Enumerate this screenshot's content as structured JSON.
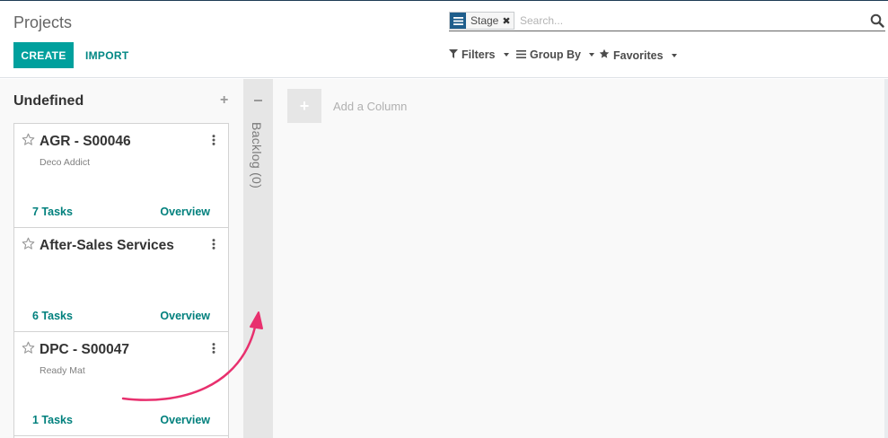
{
  "header": {
    "title": "Projects",
    "create_label": "CREATE",
    "import_label": "IMPORT"
  },
  "search": {
    "facet_value": "Stage",
    "placeholder": "Search...",
    "filters_label": "Filters",
    "groupby_label": "Group By",
    "favorites_label": "Favorites"
  },
  "kanban": {
    "column": {
      "title": "Undefined",
      "cards": [
        {
          "title": "AGR - S00046",
          "subtitle": "Deco Addict",
          "tasks": "7 Tasks",
          "overview": "Overview"
        },
        {
          "title": "After-Sales Services",
          "subtitle": "",
          "tasks": "6 Tasks",
          "overview": "Overview"
        },
        {
          "title": "DPC - S00047",
          "subtitle": "Ready Mat",
          "tasks": "1 Tasks",
          "overview": "Overview"
        }
      ]
    },
    "folded_column_label": "Backlog (0)",
    "add_column_label": "Add a Column"
  },
  "colors": {
    "primary": "#00a09d",
    "link": "#00807d",
    "facet_icon": "#1f5e8c",
    "annotation_arrow": "#e8306e"
  }
}
